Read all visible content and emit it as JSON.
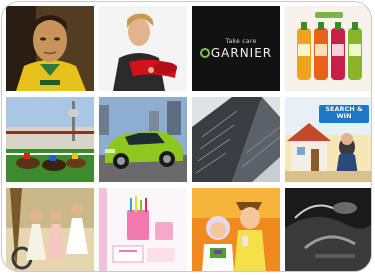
{
  "tiles": [
    {
      "name": "footballer-photo"
    },
    {
      "name": "woman-red-object-photo"
    },
    {
      "name": "garnier-ad",
      "tagline": "Take care",
      "brand": "GARNIER"
    },
    {
      "name": "juice-bottles-photo"
    },
    {
      "name": "horse-racing-photo"
    },
    {
      "name": "green-car-photo"
    },
    {
      "name": "building-architecture-photo"
    },
    {
      "name": "search-and-win-ad",
      "headline": "SEARCH & WIN"
    },
    {
      "name": "summer-dresses-photo"
    },
    {
      "name": "pink-stationery-photo"
    },
    {
      "name": "toy-story-photo"
    },
    {
      "name": "black-white-abstract-photo"
    }
  ]
}
